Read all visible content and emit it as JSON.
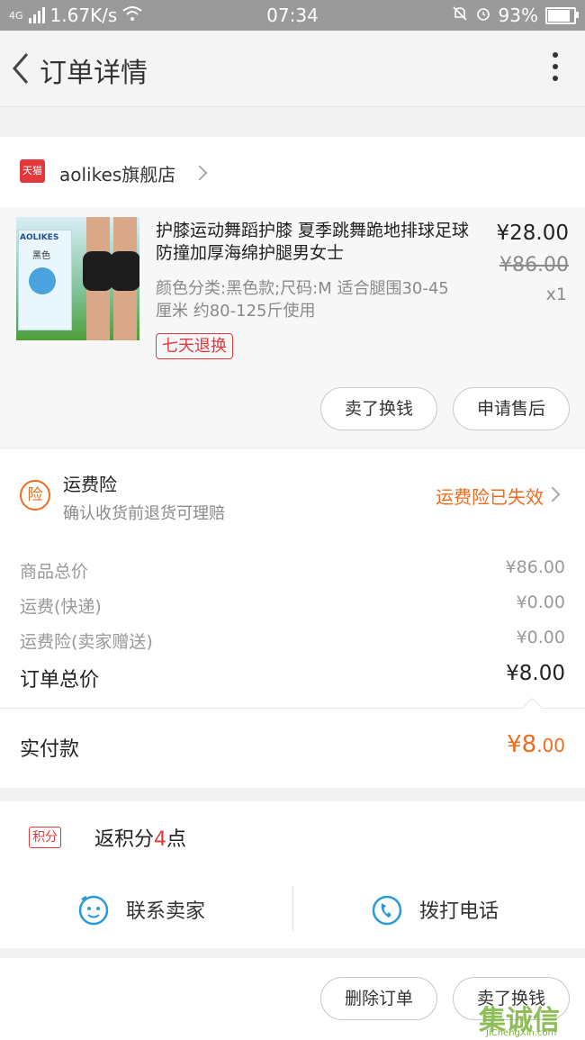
{
  "status_bar": {
    "network": "4G",
    "speed": "1.67K/s",
    "time": "07:34",
    "battery": "93%",
    "battery_level": 0.93
  },
  "nav": {
    "title": "订单详情"
  },
  "shop": {
    "name": "aolikes旗舰店",
    "badge": "天猫"
  },
  "product": {
    "title": "护膝运动舞蹈护膝 夏季跳舞跪地排球足球防撞加厚海绵护腿男女士",
    "spec": "颜色分类:黑色款;尺码:M 适合腿围30-45厘米 约80-125斤使用",
    "price": "¥28.00",
    "original_price": "¥86.00",
    "quantity": "x1",
    "tag": "七天退换",
    "image_brand": "AOLIKES",
    "image_color": "黑色"
  },
  "item_actions": {
    "sell": "卖了换钱",
    "after_sale": "申请售后"
  },
  "insurance": {
    "icon_text": "险",
    "title": "运费险",
    "subtitle": "确认收货前退货可理赔",
    "status": "运费险已失效"
  },
  "summary": {
    "rows": [
      {
        "label": "商品总价",
        "value": "¥86.00"
      },
      {
        "label": "运费(快递)",
        "value": "¥0.00"
      },
      {
        "label": "运费险(卖家赠送)",
        "value": "¥0.00"
      }
    ],
    "total_label": "订单总价",
    "total_value": "¥8.00",
    "paid_label": "实付款",
    "paid_int": "¥8",
    "paid_dec": ".00"
  },
  "points": {
    "badge": "积分",
    "prefix": "返积分",
    "count": "4",
    "suffix": "点"
  },
  "contact": {
    "seller": "联系卖家",
    "call": "拨打电话"
  },
  "bottom": {
    "delete": "删除订单",
    "sell": "卖了换钱"
  },
  "watermark": {
    "text": "集诚信",
    "url_text": "JiChengXin.com"
  },
  "colors": {
    "accent": "#ef6b1e",
    "red": "#e4393c",
    "blue": "#2a9ad8"
  }
}
